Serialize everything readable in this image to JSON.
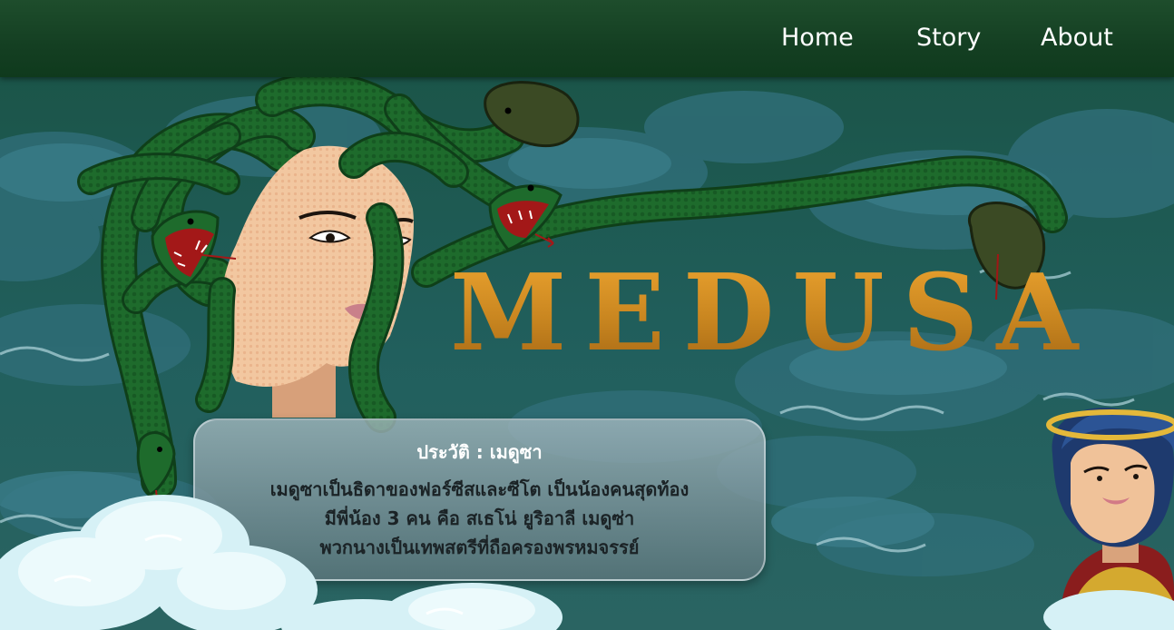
{
  "nav": {
    "items": [
      {
        "label": "Home"
      },
      {
        "label": "Story"
      },
      {
        "label": "About"
      }
    ]
  },
  "hero": {
    "title": "MEDUSA"
  },
  "info_card": {
    "title": "ประวัติ : เมดูซา",
    "lines": [
      "เมดูซาเป็นธิดาของฟอร์ซีสและซีโต เป็นน้องคนสุดท้อง",
      "มีพี่น้อง 3 คน คือ สเธโน่ ยูริอาลี เมดูซ่า",
      "พวกนางเป็นเทพสตรีที่ถือครองพรหมจรรย์"
    ]
  },
  "colors": {
    "nav_bg": "#143f22",
    "sky": "#1f5a55",
    "title_gold": "#d89425",
    "snake_green": "#1e6b2c"
  }
}
